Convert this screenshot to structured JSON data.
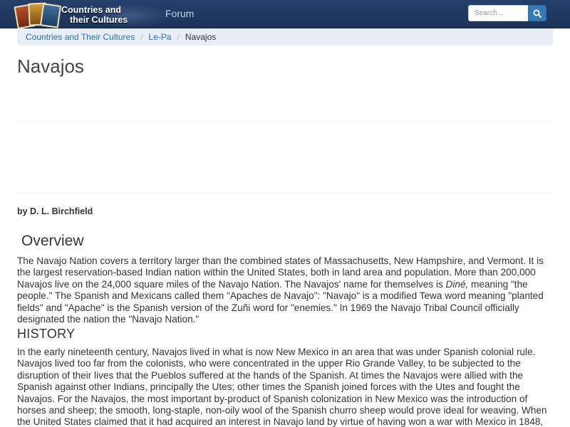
{
  "navbar": {
    "brand_line1": "Countries and",
    "brand_line2": "their Cultures",
    "forum_link": "Forum",
    "search_placeholder": "Search..."
  },
  "breadcrumb": {
    "items": [
      "Countries and Their Cultures",
      "Le-Pa"
    ],
    "current": "Navajos",
    "separator": "/"
  },
  "article": {
    "title": "Navajos",
    "author": "by D. L. Birchfield",
    "sections": [
      {
        "heading": "Overview",
        "text_before_italic": "The Navajo Nation covers a territory larger than the combined states of Massachusetts, New Hampshire, and Vermont. It is the largest reservation-based Indian nation within the United States, both in land area and population. More than 200,000 Navajos live on the 24,000 square miles of the Navajo Nation. The Navajos' name for themselves is ",
        "italic": "Diné,",
        "text_after_italic": " meaning \"the people.\" The Spanish and Mexicans called them \"Apaches de Navajo\": \"Navajo\" is a modified Tewa word meaning \"planted fields\" and \"Apache\" is the Spanish version of the Zuñi word for \"enemies.\" In 1969 the Navajo Tribal Council officially designated the nation the \"Navajo Nation.\""
      },
      {
        "heading": "HISTORY",
        "text": "In the early nineteenth century, Navajos lived in what is now New Mexico in an area that was under Spanish colonial rule. Navajos lived too far from the colonists, who were concentrated in the upper Rio Grande Valley, to be subjected to the disruption of their lives that the Pueblos suffered at the hands of the Spanish. At times the Navajos were allied with the Spanish against other Indians, principally the Utes; other times the Spanish joined forces with the Utes and fought the Navajos. For the Navajos, the most important by-product of Spanish colonization in New Mexico was the introduction of horses and sheep; the smooth, long-staple, non-oily wool of the Spanish churro sheep would prove ideal for weaving. When the United States claimed that it had acquired an interest in Navajo land by virtue of having won a war with Mexico in 1848, the Navajos were not particularly impressed. But when the U.S. Army arrived in"
      }
    ]
  },
  "colors": {
    "navbar_bg": "#1f3860",
    "link": "#2a6fb5",
    "search_button": "#337ab7",
    "breadcrumb_bg": "#e8eef6"
  },
  "icons": {
    "search_button": "search-icon"
  }
}
